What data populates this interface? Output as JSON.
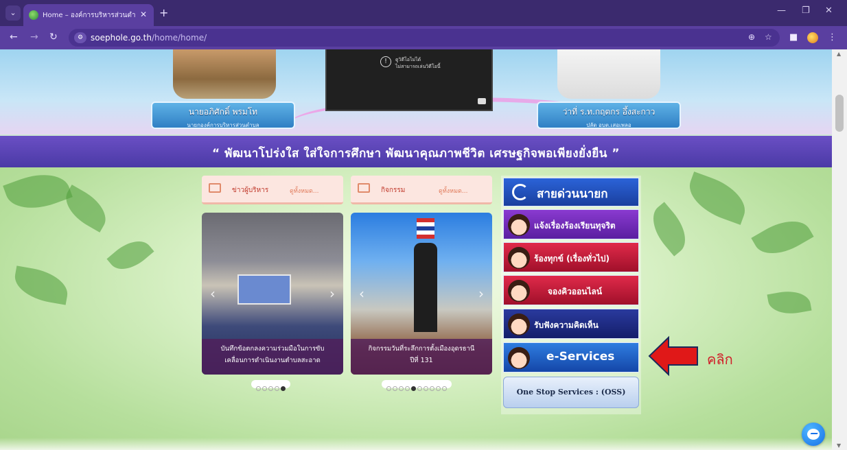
{
  "browser": {
    "tab_title": "Home – องค์การบริหารส่วนตำบลเส",
    "tab_close": "✕",
    "new_tab": "+",
    "url_host": "soephole.go.th",
    "url_path": "/home/home/",
    "icons": [
      "tab-menu-icon",
      "favicon",
      "back-icon",
      "forward-icon",
      "reload-icon",
      "site-info-icon",
      "zoom-icon",
      "star-icon",
      "sidepanel-icon",
      "profile-icon",
      "menu-icon",
      "minimize-icon",
      "maximize-icon",
      "close-icon"
    ]
  },
  "hero": {
    "left_person_name": "นายอภิศักดิ์ พรมโท",
    "left_person_position": "นายกองค์การบริหารส่วนตำบล",
    "right_person_name": "ว่าที่ ร.ท.กฤตกร อึ้งสะกาว",
    "right_person_position": "ปลัด อบต.เสอเพลอ",
    "video_message_line1": "ดูวิดีโอไม่ได้",
    "video_message_line2": "ไม่สามารถเล่นวิดีโอนี้",
    "slogan": "“ พัฒนาโปร่งใส ใส่ใจการศึกษา พัฒนาคุณภาพชีวิต เศรษฐกิจพอเพียงยั่งยืน ”"
  },
  "news": {
    "title": "ข่าวผู้บริหาร",
    "more": "ดูทั้งหมด...",
    "caption_line1": "บันทึกข้อตกลงความร่วมมือในการขับ",
    "caption_line2": "เคลื่อนการดำเนินงานตำบลสะอาด",
    "dot_count": 5,
    "active_dot": 5
  },
  "activity": {
    "title": "กิจกรรม",
    "more": "ดูทั้งหมด...",
    "caption_line1": "กิจกรรมวันที่ระลึกการตั้งเมืองอุดรธานี",
    "caption_line2": "ปีที่ 131",
    "dot_count": 10,
    "active_dot": 5
  },
  "services": {
    "hotline": "สายด่วนนายก",
    "complaint_corruption": "แจ้งเรื่องร้องเรียนทุจริต",
    "complaint_general": "ร้องทุกข์ (เรื่องทั่วไป)",
    "online_queue": "จองคิวออนไลน์",
    "feedback": "รับฟังความคิดเห็น",
    "eservices": "e-Services",
    "oss": "One Stop Services : (OSS)"
  },
  "annotation": {
    "text": "คลิก",
    "color": "#d0202a"
  },
  "colors": {
    "chrome": "#3b2a6e",
    "toolbar": "#5a3fa0",
    "slogan_bar": "#5a45b8",
    "hotline": "#1f4fbd"
  }
}
